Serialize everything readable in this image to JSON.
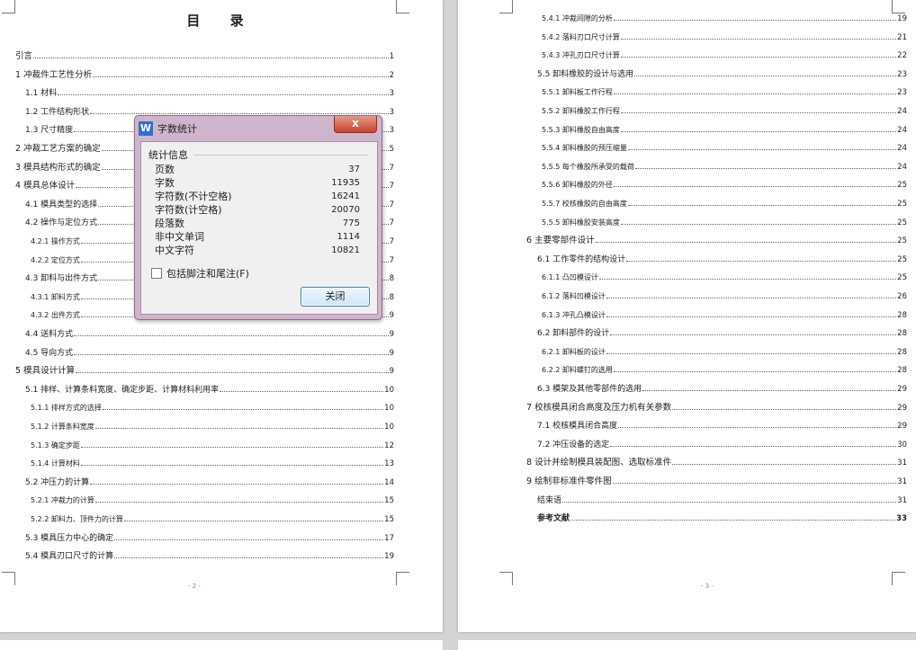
{
  "left_page": {
    "title": "目 录",
    "footer": "- 2 -",
    "entries": [
      {
        "text": "引言",
        "page": "1",
        "level": 1
      },
      {
        "text": "1 冲裁件工艺性分析",
        "page": "2",
        "level": 1
      },
      {
        "text": "1.1 材料",
        "page": "3",
        "level": 2
      },
      {
        "text": "1.2 工件结构形状",
        "page": "3",
        "level": 2
      },
      {
        "text": "1.3 尺寸精度",
        "page": "3",
        "level": 2
      },
      {
        "text": "2 冲裁工艺方案的确定",
        "page": "5",
        "level": 1
      },
      {
        "text": "3 模具结构形式的确定",
        "page": "7",
        "level": 1
      },
      {
        "text": "4 模具总体设计",
        "page": "7",
        "level": 1
      },
      {
        "text": "4.1 模具类型的选择",
        "page": "7",
        "level": 2
      },
      {
        "text": "4.2 操作与定位方式",
        "page": "7",
        "level": 2
      },
      {
        "text": "4.2.1 操作方式",
        "page": "7",
        "level": 3
      },
      {
        "text": "4.2.2 定位方式",
        "page": "7",
        "level": 3
      },
      {
        "text": "4.3 卸料与出件方式",
        "page": "8",
        "level": 2
      },
      {
        "text": "4.3.1 卸料方式",
        "page": "8",
        "level": 3
      },
      {
        "text": "4.3.2 出件方式",
        "page": "9",
        "level": 3
      },
      {
        "text": "4.4 送料方式",
        "page": "9",
        "level": 2
      },
      {
        "text": "4.5 导向方式",
        "page": "9",
        "level": 2
      },
      {
        "text": "5 模具设计计算",
        "page": "9",
        "level": 1
      },
      {
        "text": "5.1 排样、计算条料宽度、确定步距、计算材料利用率",
        "page": "10",
        "level": 2
      },
      {
        "text": "5.1.1 排样方式的选择",
        "page": "10",
        "level": 3
      },
      {
        "text": "5.1.2 计算条料宽度",
        "page": "10",
        "level": 3
      },
      {
        "text": "5.1.3 确定步距",
        "page": "12",
        "level": 3
      },
      {
        "text": "5.1.4 计算材料",
        "page": "13",
        "level": 3
      },
      {
        "text": "5.2 冲压力的计算",
        "page": "14",
        "level": 2
      },
      {
        "text": "5.2.1 冲裁力的计算",
        "page": "15",
        "level": 3
      },
      {
        "text": "5.2.2 卸料力、顶件力的计算",
        "page": "15",
        "level": 3
      },
      {
        "text": "5.3 模具压力中心的确定",
        "page": "17",
        "level": 2
      },
      {
        "text": "5.4 模具刃口尺寸的计算",
        "page": "19",
        "level": 2
      }
    ]
  },
  "right_page": {
    "footer": "- 3 -",
    "entries": [
      {
        "text": "5.4.1 冲裁间隙的分析",
        "page": "19",
        "level": 3
      },
      {
        "text": "5.4.2 落料刃口尺寸计算",
        "page": "21",
        "level": 3
      },
      {
        "text": "5.4.3 冲孔刃口尺寸计算",
        "page": "22",
        "level": 3
      },
      {
        "text": "5.5 卸料橡胶的设计与选用",
        "page": "23",
        "level": 2
      },
      {
        "text": "5.5.1 卸料板工作行程",
        "page": "23",
        "level": 3
      },
      {
        "text": "5.5.2 卸料橡胶工作行程",
        "page": "24",
        "level": 3
      },
      {
        "text": "5.5.3 卸料橡胶自由高度",
        "page": "24",
        "level": 3
      },
      {
        "text": "5.5.4 卸料橡胶的预压缩量",
        "page": "24",
        "level": 3
      },
      {
        "text": "5.5.5 每个橡胶所承受的载荷",
        "page": "24",
        "level": 3
      },
      {
        "text": "5.5.6 卸料橡胶的外径",
        "page": "25",
        "level": 3
      },
      {
        "text": "5.5.7 校核橡胶的自由高度",
        "page": "25",
        "level": 3
      },
      {
        "text": "5.5.5 卸料橡胶安装高度",
        "page": "25",
        "level": 3
      },
      {
        "text": "6 主要零部件设计",
        "page": "25",
        "level": 1
      },
      {
        "text": "6.1 工作零件的结构设计",
        "page": "25",
        "level": 2
      },
      {
        "text": "6.1.1 凸凹模设计",
        "page": "25",
        "level": 3
      },
      {
        "text": "6.1.2 落料凹模设计",
        "page": "26",
        "level": 3
      },
      {
        "text": "6.1.3 冲孔凸模设计",
        "page": "28",
        "level": 3
      },
      {
        "text": "6.2 卸料部件的设计",
        "page": "28",
        "level": 2
      },
      {
        "text": "6.2.1 卸料板的设计",
        "page": "28",
        "level": 3
      },
      {
        "text": "6.2.2 卸料螺钉的选用",
        "page": "28",
        "level": 3
      },
      {
        "text": "6.3 模架及其他零部件的选用",
        "page": "29",
        "level": 2
      },
      {
        "text": "7 校核模具闭合高度及压力机有关参数",
        "page": "29",
        "level": 1
      },
      {
        "text": "7.1 校核模具闭合高度",
        "page": "29",
        "level": 2
      },
      {
        "text": "7.2 冲压设备的选定",
        "page": "30",
        "level": 2
      },
      {
        "text": "8 设计并绘制模具装配图、选取标准件",
        "page": "31",
        "level": 1
      },
      {
        "text": "9 绘制非标准件零件图",
        "page": "31",
        "level": 1
      },
      {
        "text": "结束语",
        "page": "31",
        "level": 2
      },
      {
        "text": "参考文献",
        "page": "33",
        "level": 2,
        "bold": true
      }
    ]
  },
  "dialog": {
    "logo": "W",
    "title": "字数统计",
    "close_x": "x",
    "group_title": "统计信息",
    "stats": [
      {
        "label": "页数",
        "value": "37"
      },
      {
        "label": "字数",
        "value": "11935"
      },
      {
        "label": "字符数(不计空格)",
        "value": "16241"
      },
      {
        "label": "字符数(计空格)",
        "value": "20070"
      },
      {
        "label": "段落数",
        "value": "775"
      },
      {
        "label": "非中文单词",
        "value": "1114"
      },
      {
        "label": "中文字符",
        "value": "10821"
      }
    ],
    "checkbox_label": "包括脚注和尾注(F)",
    "checkbox_checked": false,
    "close_button": "关闭"
  }
}
